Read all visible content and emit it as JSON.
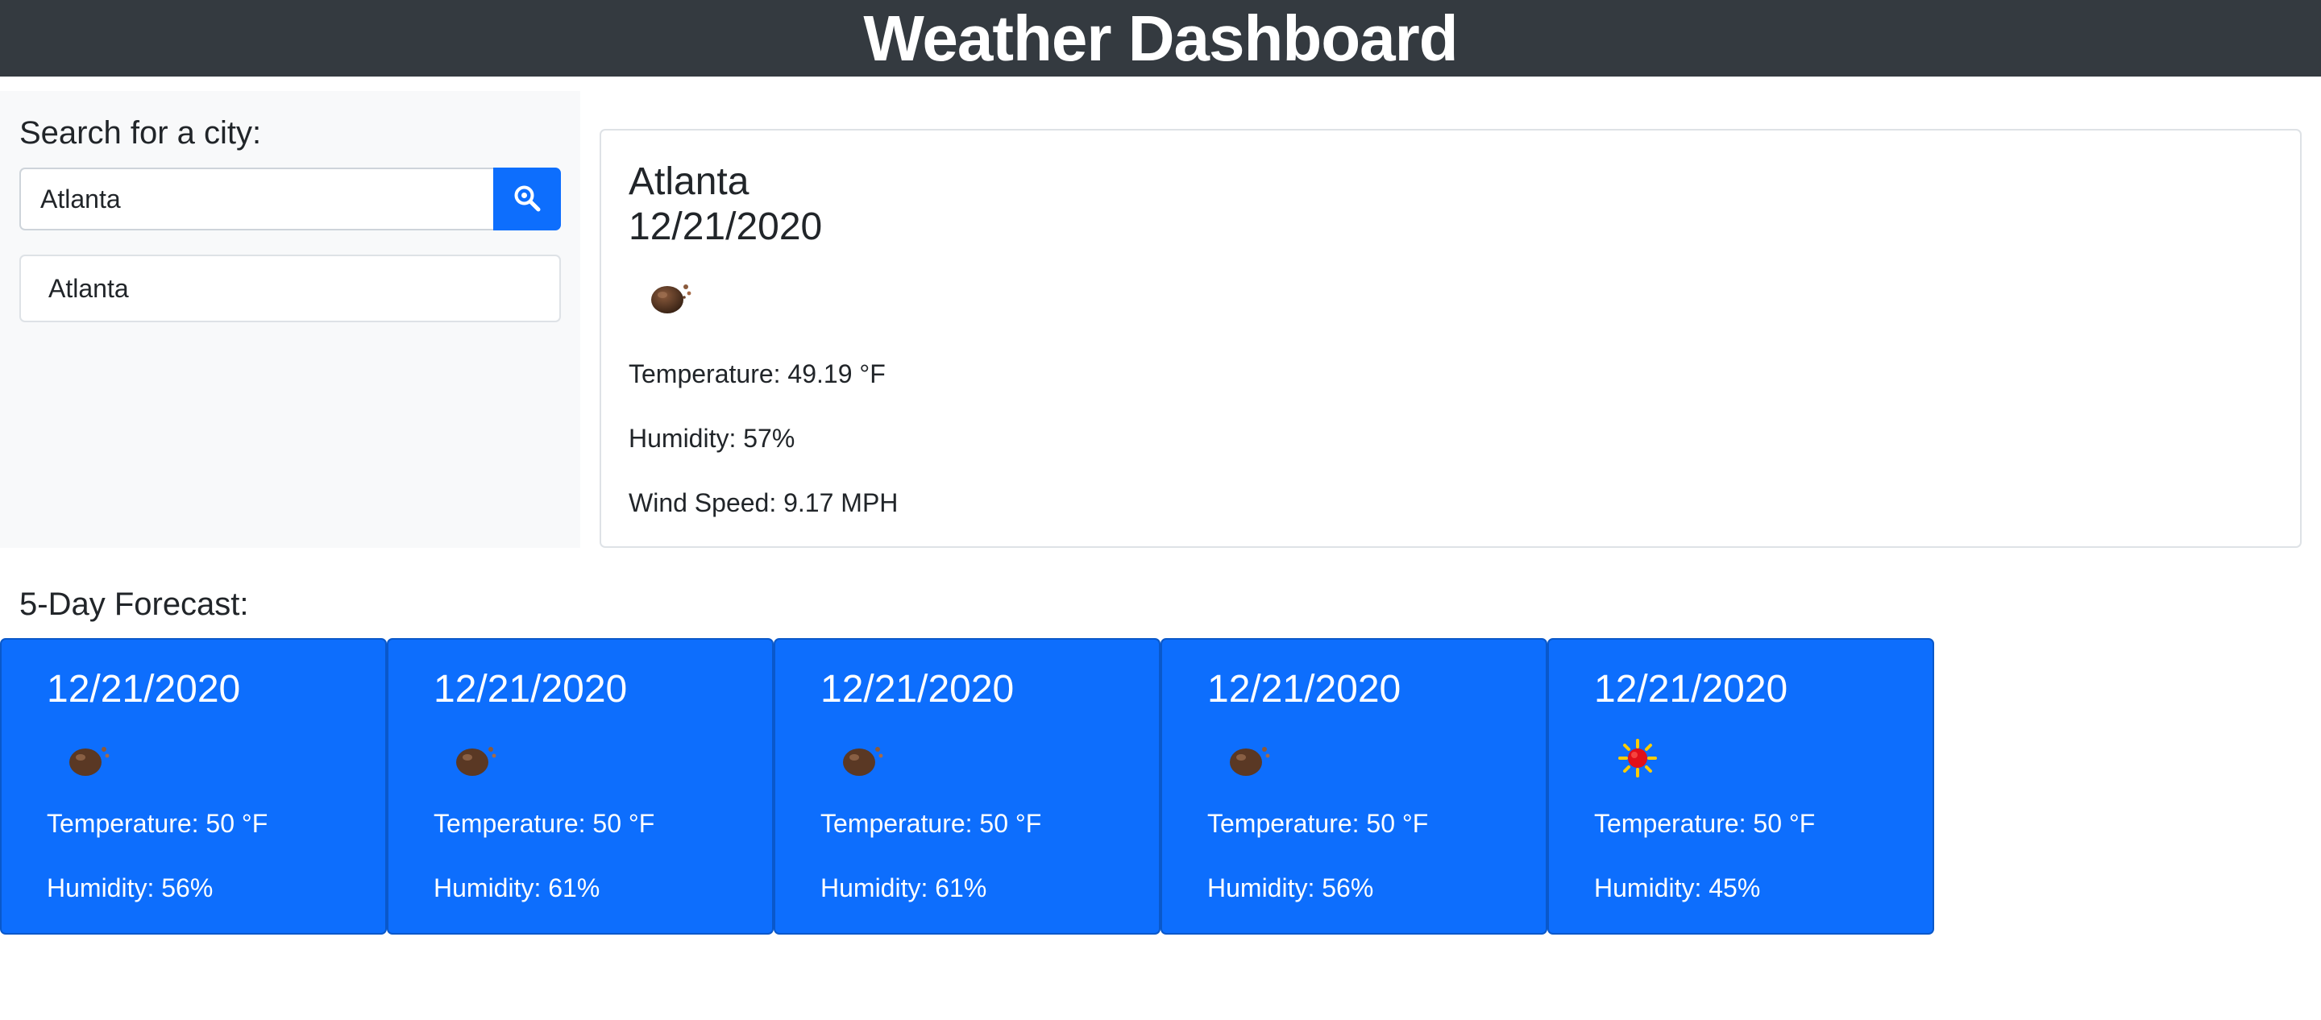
{
  "header": {
    "title": "Weather Dashboard"
  },
  "sidebar": {
    "label": "Search for a city:",
    "search": {
      "value": "Atlanta",
      "placeholder": ""
    },
    "history": [
      {
        "label": "Atlanta"
      }
    ]
  },
  "current": {
    "city": "Atlanta",
    "date": "12/21/2020",
    "icon": "cloud-icon",
    "temperature": "Temperature: 49.19 °F",
    "humidity": "Humidity: 57%",
    "wind": "Wind Speed: 9.17 MPH"
  },
  "forecast": {
    "title": "5-Day Forecast:",
    "days": [
      {
        "date": "12/21/2020",
        "icon": "cloud-icon",
        "temp": "Temperature: 50 °F",
        "humidity": "Humidity: 56%"
      },
      {
        "date": "12/21/2020",
        "icon": "cloud-icon",
        "temp": "Temperature: 50 °F",
        "humidity": "Humidity: 61%"
      },
      {
        "date": "12/21/2020",
        "icon": "cloud-icon",
        "temp": "Temperature: 50 °F",
        "humidity": "Humidity: 61%"
      },
      {
        "date": "12/21/2020",
        "icon": "cloud-icon",
        "temp": "Temperature: 50 °F",
        "humidity": "Humidity: 56%"
      },
      {
        "date": "12/21/2020",
        "icon": "sun-icon",
        "temp": "Temperature: 50 °F",
        "humidity": "Humidity: 45%"
      }
    ]
  },
  "colors": {
    "header_bg": "#343a40",
    "accent": "#0d6efd",
    "sidebar_bg": "#f8f9fa",
    "border": "#dee2e6"
  }
}
